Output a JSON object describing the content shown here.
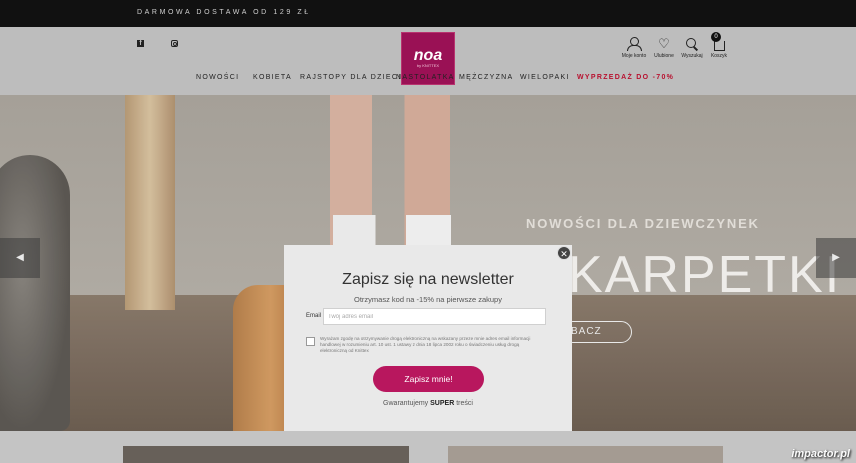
{
  "topbar": {
    "promo": "DARMOWA DOSTAWA OD 129 ZŁ"
  },
  "header": {
    "logo": {
      "mark": "noa",
      "sub": "by KNITTEX"
    },
    "social": {
      "facebook": "f",
      "instagram": ""
    },
    "account": {
      "label": "Moje konto",
      "icon": "user-icon"
    },
    "wishlist": {
      "label": "Ulubione",
      "icon": "heart-icon"
    },
    "search": {
      "label": "Wyszukaj",
      "icon": "search-icon"
    },
    "cart": {
      "label": "Koszyk",
      "icon": "cart-icon",
      "count": "0"
    }
  },
  "nav": {
    "items": [
      "NOWOŚCI",
      "KOBIETA",
      "RAJSTOPY DLA DZIECI",
      "NASTOLATKA",
      "MĘŻCZYZNA",
      "WIELOPAKI"
    ],
    "sale": "WYPRZEDAŻ DO -70%",
    "sale_color": "#b8112f"
  },
  "hero": {
    "kicker": "NOWOŚCI DLA DZIEWCZYNEK",
    "title": "KARPETKI",
    "cta": "BACZ",
    "prev_icon": "chevron-left-icon",
    "next_icon": "chevron-right-icon"
  },
  "modal": {
    "close": "✕",
    "title": "Zapisz się na newsletter",
    "subtitle": "Otrzymasz kod na -15% na pierwsze zakupy",
    "email_label": "Email",
    "email_placeholder": "Twój adres email",
    "email_value": "",
    "consent": "Wyrażam zgodę na otrzymywanie drogą elektroniczną na wskazany przeze mnie adres email informacji handlowej w rozumieniu art. 10 ust. 1 ustawy z dnia 18 lipca 2002 roku o świadczeniu usług drogą elektroniczną od Knittex",
    "submit": "Zapisz mnie!",
    "guarantee_prefix": "Gwarantujemy",
    "guarantee_bold": "SUPER",
    "guarantee_suffix": "treści",
    "accent_color": "#b8175e"
  },
  "watermark": "impactor.pl"
}
